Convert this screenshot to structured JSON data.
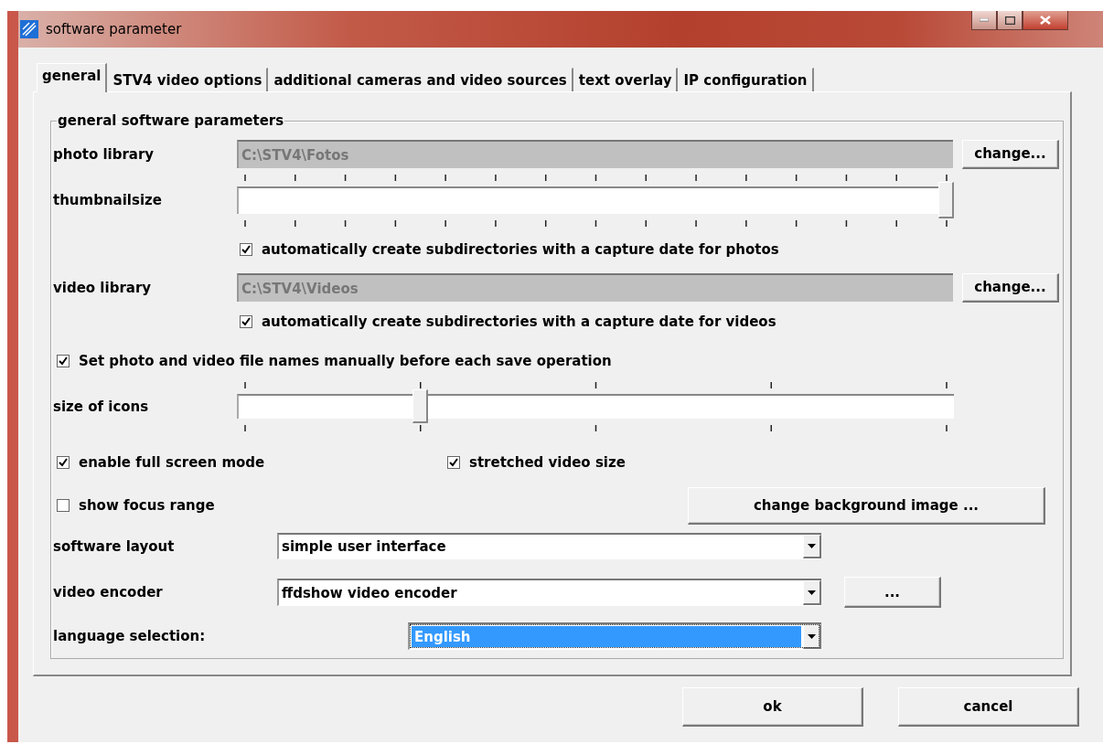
{
  "window": {
    "title": "software parameter"
  },
  "tabs": [
    {
      "label": "general",
      "selected": true
    },
    {
      "label": "STV4 video options",
      "selected": false
    },
    {
      "label": "additional cameras and video sources",
      "selected": false
    },
    {
      "label": "text overlay",
      "selected": false
    },
    {
      "label": "IP configuration",
      "selected": false
    }
  ],
  "group_title": "general software parameters",
  "photo_library": {
    "label": "photo library",
    "value": "C:\\STV4\\Fotos",
    "button": "change..."
  },
  "thumbnail_size": {
    "label": "thumbnailsize",
    "level": 1
  },
  "photo_subdirs": {
    "label": "automatically create subdirectories with a capture date for photos",
    "checked": true
  },
  "video_library": {
    "label": "video library",
    "value": "C:\\STV4\\Videos",
    "button": "change..."
  },
  "video_subdirs": {
    "label": "automatically create subdirectories with a capture date for videos",
    "checked": true
  },
  "manual_names": {
    "label": "Set photo and video file names manually before each save operation",
    "checked": true
  },
  "icon_size": {
    "label": "size of icons",
    "level": 0.25
  },
  "full_screen": {
    "label": "enable full screen mode",
    "checked": true
  },
  "stretched": {
    "label": "stretched video size",
    "checked": true
  },
  "focus_range": {
    "label": "show focus range",
    "checked": false
  },
  "background_button": "change background image ...",
  "software_layout": {
    "label": "software layout",
    "value": "simple user interface",
    "highlighted": false
  },
  "video_encoder": {
    "label": "video encoder",
    "value": "ffdshow video encoder",
    "highlighted": false,
    "button": "..."
  },
  "language": {
    "label": "language selection:",
    "value": "English",
    "highlighted": true
  },
  "buttons": [
    {
      "label": "ok"
    },
    {
      "label": "cancel"
    }
  ]
}
